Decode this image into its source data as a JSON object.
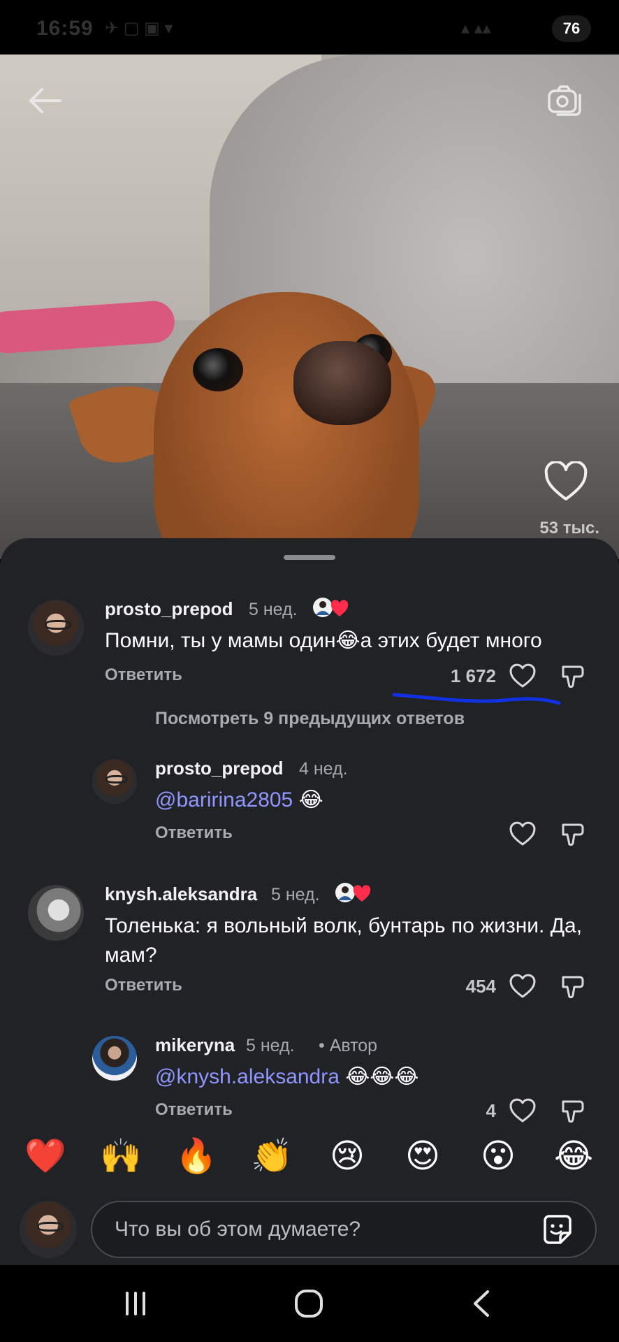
{
  "status_bar": {
    "time": "16:59",
    "battery": "76"
  },
  "video": {
    "likes": "53 тыс."
  },
  "comments": [
    {
      "username": "prosto_prepod",
      "age": "5 нед.",
      "text": "Помни, ты у мамы один😂а этих будет много",
      "reply_label": "Ответить",
      "likes": "1 672"
    },
    {
      "username": "knysh.aleksandra",
      "age": "5 нед.",
      "text": "Толенька:  я вольный волк, бунтарь по жизни. Да, мам?",
      "reply_label": "Ответить",
      "likes": "454"
    }
  ],
  "see_more": "Посмотреть 9 предыдущих ответов",
  "replies": [
    {
      "username": "prosto_prepod",
      "age": "4 нед.",
      "mention": "@baririna2805",
      "emoji": " 😂",
      "reply_label": "Ответить"
    },
    {
      "username": "mikeryna",
      "age": "5 нед.",
      "author_tag": "• Автор",
      "mention": "@knysh.aleksandra",
      "emoji": " 😂😂😂",
      "reply_label": "Ответить",
      "likes": "4"
    }
  ],
  "reactions": [
    "❤️",
    "🙌",
    "🔥",
    "👏",
    "😢",
    "😍",
    "😮",
    "😂"
  ],
  "input": {
    "placeholder": "Что вы об этом думаете?"
  },
  "colors": {
    "sheet": "#212226",
    "mention": "#8f96ff",
    "annotation": "#1130e0"
  },
  "icons": [
    "back-arrow-icon",
    "camera-icon",
    "heart-icon",
    "dislike-icon",
    "sticker-icon",
    "recent-apps-icon",
    "home-icon",
    "nav-back-icon"
  ]
}
